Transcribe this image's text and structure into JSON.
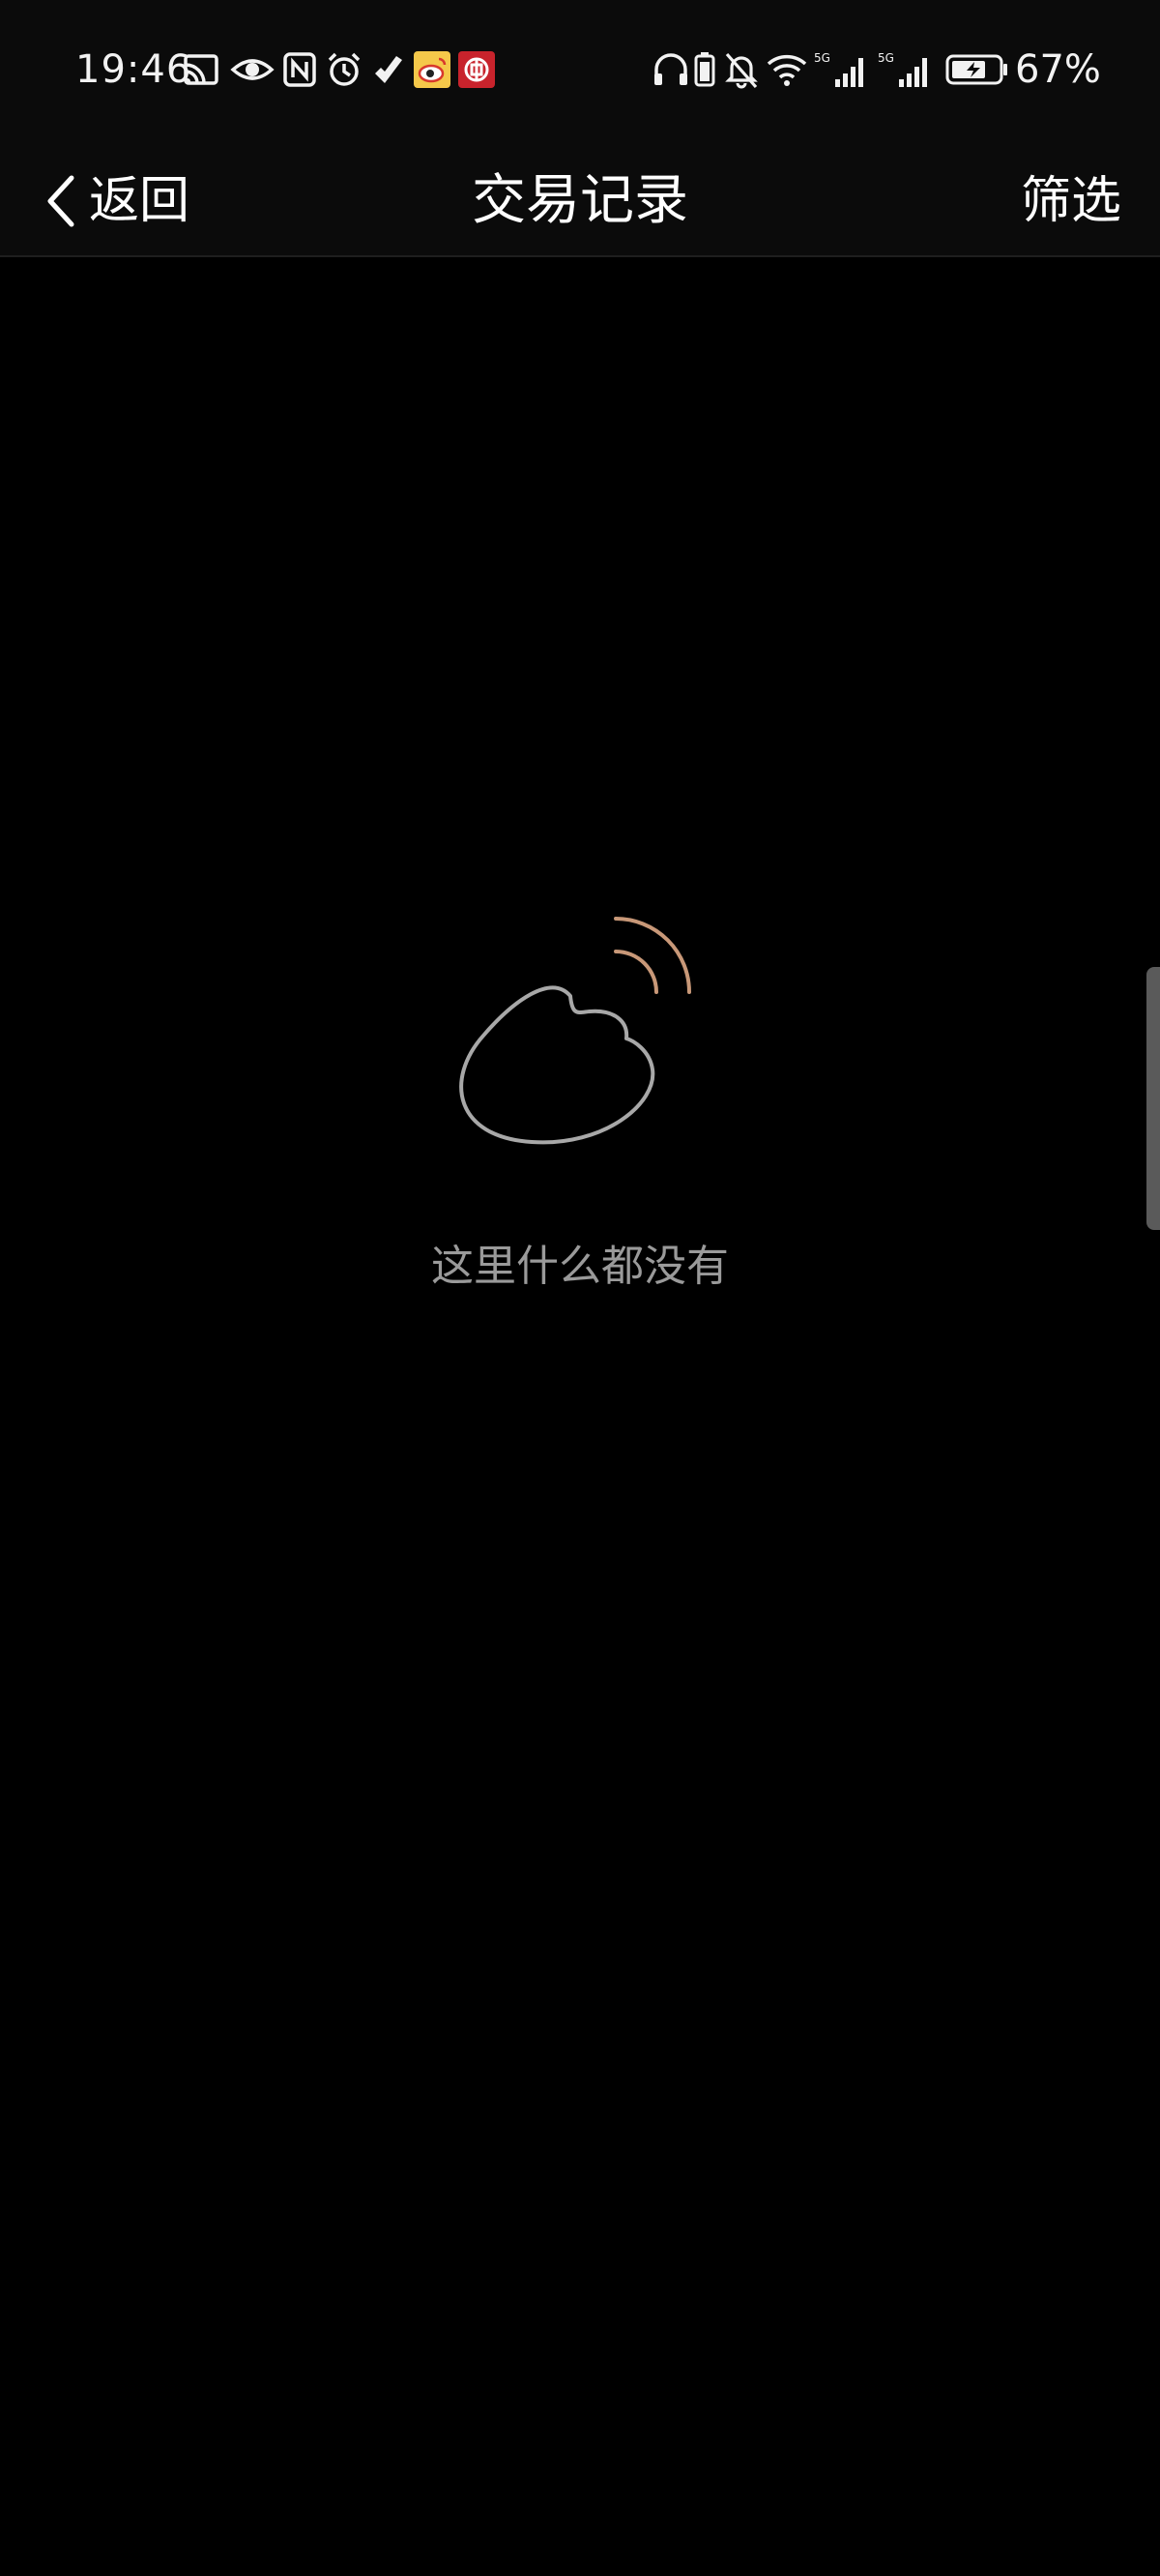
{
  "status_bar": {
    "time": "19:46",
    "battery_percent": "67%",
    "icons_left": [
      "cast-icon",
      "eye-icon",
      "nfc-icon",
      "alarm-icon",
      "health-icon",
      "weibo-icon",
      "bank-app-icon"
    ],
    "icons_right": [
      "headphones-icon",
      "battery-saver-icon",
      "mute-icon",
      "wifi-icon",
      "signal-5g-sim1-icon",
      "signal-5g-sim2-icon",
      "battery-icon"
    ],
    "signal_label_1": "5G",
    "signal_label_2": "5G"
  },
  "nav": {
    "back_label": "返回",
    "title": "交易记录",
    "filter_label": "筛选"
  },
  "empty_state": {
    "message": "这里什么都没有",
    "illustration": "empty-shell-icon"
  },
  "colors": {
    "background": "#000000",
    "bar_background": "#0b0b0b",
    "empty_text": "#9a9a9a",
    "illustration_stroke": "#a8a8a8",
    "illustration_accent": "#c89878"
  }
}
